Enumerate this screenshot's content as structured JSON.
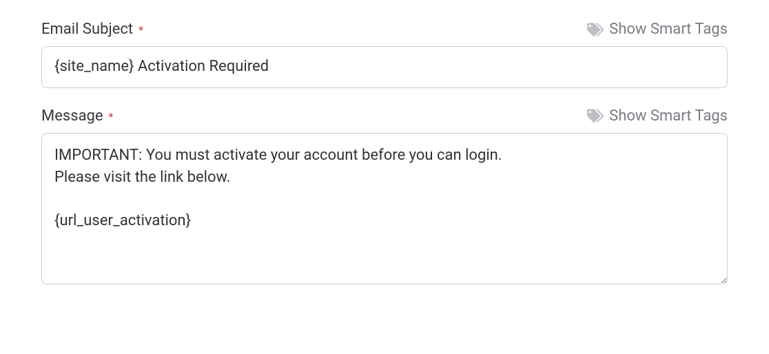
{
  "subject": {
    "label": "Email Subject",
    "required_marker": "*",
    "smart_tags_label": "Show Smart Tags",
    "value": "{site_name} Activation Required"
  },
  "message": {
    "label": "Message",
    "required_marker": "*",
    "smart_tags_label": "Show Smart Tags",
    "value": "IMPORTANT: You must activate your account before you can login.\nPlease visit the link below.\n\n{url_user_activation}"
  }
}
